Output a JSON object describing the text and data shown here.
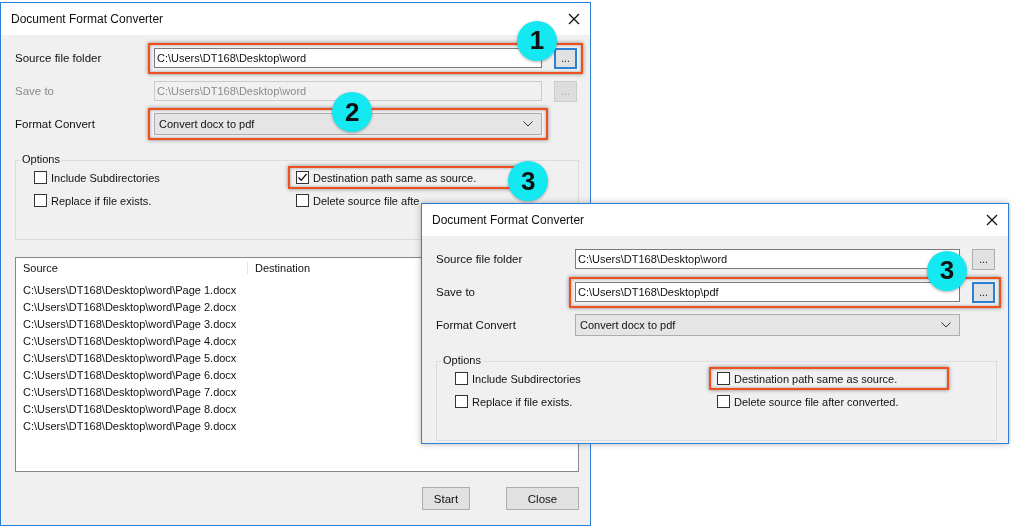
{
  "windows": [
    {
      "title": "Document Format Converter",
      "fields": [
        {
          "label": "Source file folder",
          "value": "C:\\Users\\DT168\\Desktop\\word",
          "browse": "...",
          "disabled": false,
          "highlighted": true,
          "browse_focused": true,
          "callout": "1"
        },
        {
          "label": "Save to",
          "value": "C:\\Users\\DT168\\Desktop\\word",
          "browse": "...",
          "disabled": true,
          "highlighted": false,
          "browse_focused": false
        }
      ],
      "format": {
        "label": "Format Convert",
        "value": "Convert docx to pdf",
        "highlighted": true,
        "callout": "2"
      },
      "options": {
        "title": "Options",
        "items": [
          {
            "label": "Include Subdirectories",
            "checked": false,
            "highlighted": false
          },
          {
            "label": "Destination path same as source.",
            "checked": true,
            "highlighted": true,
            "callout": "3"
          },
          {
            "label": "Replace if file exists.",
            "checked": false,
            "highlighted": false
          },
          {
            "label": "Delete source file afte",
            "checked": false,
            "highlighted": false
          }
        ]
      },
      "list": {
        "columns": [
          "Source",
          "Destination"
        ],
        "rows": [
          "C:\\Users\\DT168\\Desktop\\word\\Page 1.docx",
          "C:\\Users\\DT168\\Desktop\\word\\Page 2.docx",
          "C:\\Users\\DT168\\Desktop\\word\\Page 3.docx",
          "C:\\Users\\DT168\\Desktop\\word\\Page 4.docx",
          "C:\\Users\\DT168\\Desktop\\word\\Page 5.docx",
          "C:\\Users\\DT168\\Desktop\\word\\Page 6.docx",
          "C:\\Users\\DT168\\Desktop\\word\\Page 7.docx",
          "C:\\Users\\DT168\\Desktop\\word\\Page 8.docx",
          "C:\\Users\\DT168\\Desktop\\word\\Page 9.docx"
        ]
      },
      "buttons": [
        "Start",
        "Close"
      ]
    },
    {
      "title": "Document Format Converter",
      "fields": [
        {
          "label": "Source file folder",
          "value": "C:\\Users\\DT168\\Desktop\\word",
          "browse": "...",
          "disabled": false,
          "highlighted": false,
          "browse_focused": false
        },
        {
          "label": "Save to",
          "value": "C:\\Users\\DT168\\Desktop\\pdf",
          "browse": "...",
          "disabled": false,
          "highlighted": true,
          "browse_focused": true,
          "callout": "3"
        }
      ],
      "format": {
        "label": "Format Convert",
        "value": "Convert docx to pdf",
        "highlighted": false
      },
      "options": {
        "title": "Options",
        "items": [
          {
            "label": "Include Subdirectories",
            "checked": false,
            "highlighted": false
          },
          {
            "label": "Destination path same as source.",
            "checked": false,
            "highlighted": true
          },
          {
            "label": "Replace if file exists.",
            "checked": false,
            "highlighted": false
          },
          {
            "label": "Delete source file after converted.",
            "checked": false,
            "highlighted": false
          }
        ]
      }
    }
  ]
}
